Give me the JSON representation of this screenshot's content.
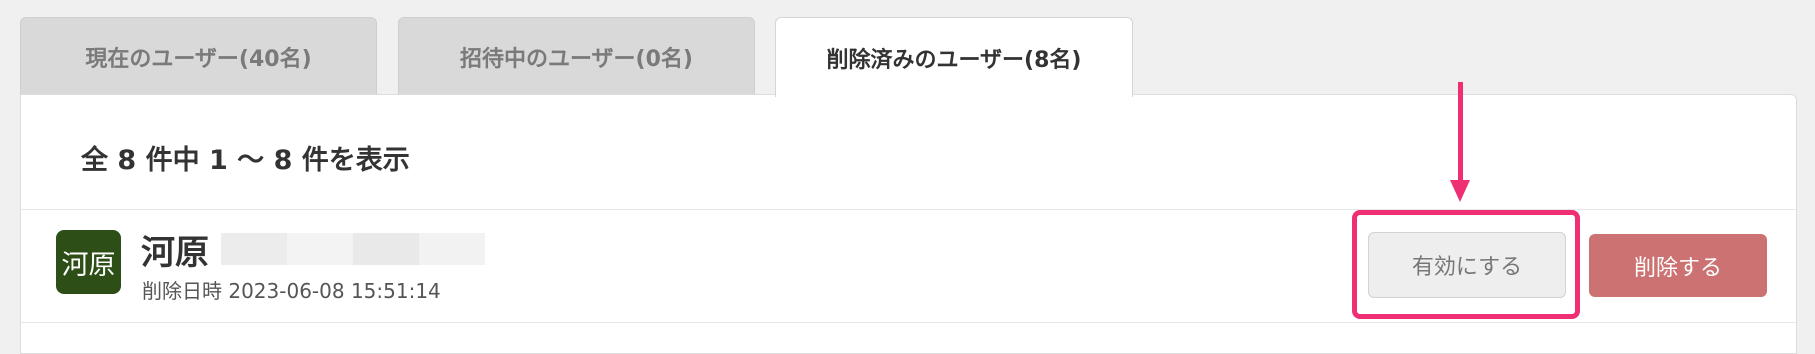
{
  "tabs": [
    {
      "label": "現在のユーザー(40名)",
      "active": false
    },
    {
      "label": "招待中のユーザー(0名)",
      "active": false
    },
    {
      "label": "削除済みのユーザー(8名)",
      "active": true
    }
  ],
  "summary": "全 8 件中 1 〜 8 件を表示",
  "user": {
    "avatar_text": "河原",
    "name": "河原",
    "deleted_at": "削除日時 2023-06-08 15:51:14"
  },
  "actions": {
    "activate_label": "有効にする",
    "delete_label": "削除する"
  },
  "colors": {
    "avatar_bg": "#2d4f17",
    "delete_button": "#cc7272",
    "annotation": "#ef2f74"
  },
  "annotation": {
    "icon": "arrow-down-icon",
    "target": "activate-button"
  }
}
